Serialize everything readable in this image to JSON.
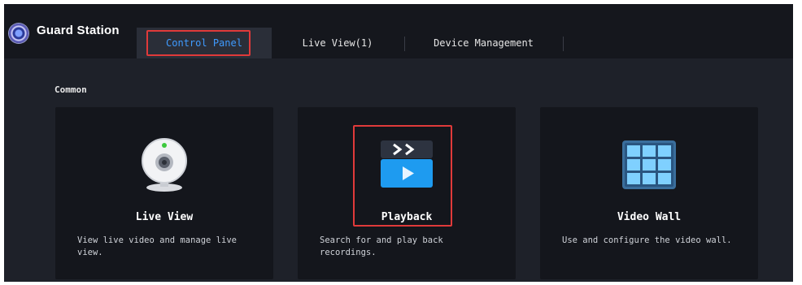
{
  "app": {
    "title": "Guard Station",
    "logo_icon": "guard-station-logo-icon"
  },
  "tabs": [
    {
      "label": "Control Panel",
      "active": true
    },
    {
      "label": "Live View(1)",
      "active": false
    },
    {
      "label": "Device Management",
      "active": false
    }
  ],
  "section": {
    "label": "Common"
  },
  "cards": [
    {
      "title": "Live View",
      "description": "View live video and manage live view.",
      "icon": "webcam-icon"
    },
    {
      "title": "Playback",
      "description": "Search for and play back recordings.",
      "icon": "playback-icon"
    },
    {
      "title": "Video Wall",
      "description": "Use and configure the video wall.",
      "icon": "video-wall-icon"
    }
  ],
  "colors": {
    "accent": "#3f9bff",
    "highlight": "#e03a3a",
    "background": "#1e2129",
    "card": "#14161c"
  }
}
